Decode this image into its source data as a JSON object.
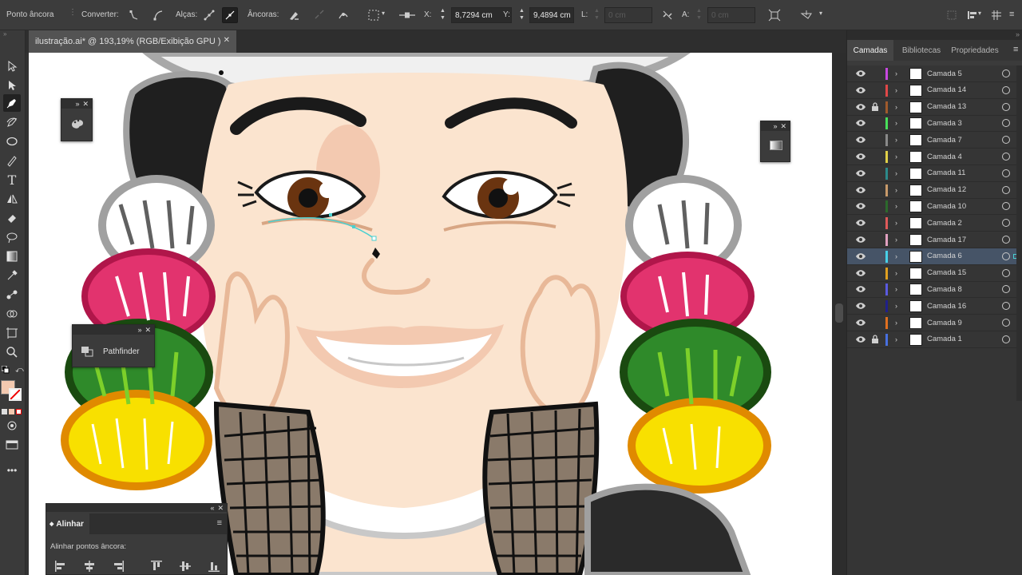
{
  "control_bar": {
    "mode_label": "Ponto âncora",
    "convert_label": "Converter:",
    "handles_label": "Alças:",
    "anchors_label": "Âncoras:",
    "x_label": "X:",
    "x_value": "8,7294 cm",
    "y_label": "Y:",
    "y_value": "9,4894 cm",
    "w_label": "L:",
    "w_value": "0 cm",
    "h_label": "A:",
    "h_value": "0 cm"
  },
  "document_tab": {
    "title": "ilustração.ai* @ 193,19% (RGB/Exibição GPU )"
  },
  "floating_panels": {
    "pathfinder_label": "Pathfinder",
    "alinhar_title": "Alinhar",
    "alinhar_subtitle": "Alinhar pontos âncora:"
  },
  "right_panel": {
    "tabs": [
      "Camadas",
      "Bibliotecas",
      "Propriedades"
    ],
    "active_tab": "Camadas",
    "layers": [
      {
        "name": "Camada 5",
        "color": "#c848e0",
        "locked": false,
        "selected": false
      },
      {
        "name": "Camada 14",
        "color": "#e04848",
        "locked": false,
        "selected": false
      },
      {
        "name": "Camada 13",
        "color": "#a05a2c",
        "locked": true,
        "selected": false
      },
      {
        "name": "Camada 3",
        "color": "#48e05a",
        "locked": false,
        "selected": false
      },
      {
        "name": "Camada 7",
        "color": "#8a8a8a",
        "locked": false,
        "selected": false
      },
      {
        "name": "Camada 4",
        "color": "#e0d048",
        "locked": false,
        "selected": false
      },
      {
        "name": "Camada 11",
        "color": "#2c8a8a",
        "locked": false,
        "selected": false
      },
      {
        "name": "Camada 12",
        "color": "#c89a6a",
        "locked": false,
        "selected": false
      },
      {
        "name": "Camada 10",
        "color": "#2c6a2c",
        "locked": false,
        "selected": false
      },
      {
        "name": "Camada 2",
        "color": "#e05a5a",
        "locked": false,
        "selected": false
      },
      {
        "name": "Camada 17",
        "color": "#e0a0c0",
        "locked": false,
        "selected": false
      },
      {
        "name": "Camada 6",
        "color": "#48d0e8",
        "locked": false,
        "selected": true
      },
      {
        "name": "Camada 15",
        "color": "#e0a020",
        "locked": false,
        "selected": false
      },
      {
        "name": "Camada 8",
        "color": "#5a5ae0",
        "locked": false,
        "selected": false
      },
      {
        "name": "Camada 16",
        "color": "#20208a",
        "locked": false,
        "selected": false
      },
      {
        "name": "Camada 9",
        "color": "#e07020",
        "locked": false,
        "selected": false
      },
      {
        "name": "Camada 1",
        "color": "#4870e0",
        "locked": true,
        "selected": false
      }
    ]
  },
  "colors": {
    "accent": "#465467",
    "fill_swatch": "#f3c9b0",
    "path_highlight": "#4ad0d0"
  }
}
